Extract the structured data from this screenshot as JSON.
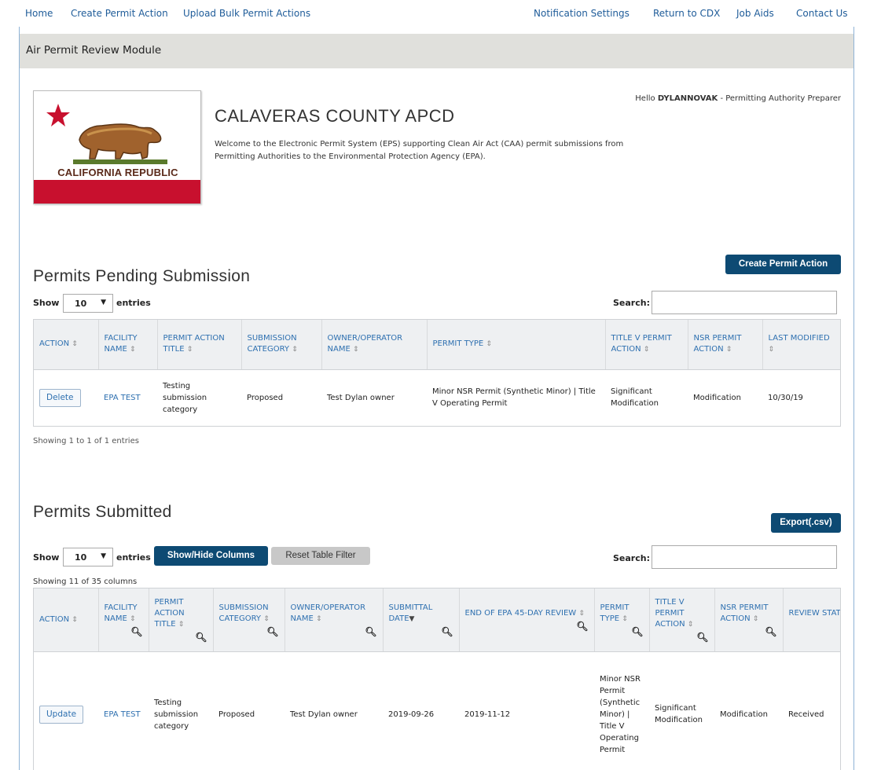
{
  "nav": {
    "left": [
      "Home",
      "Create Permit Action",
      "Upload Bulk Permit Actions"
    ],
    "right": [
      "Notification Settings",
      "Return to CDX",
      "Job Aids",
      "Contact Us"
    ]
  },
  "module_title": "Air Permit Review Module",
  "flag_text": "CALIFORNIA REPUBLIC",
  "agency_name": "CALAVERAS COUNTY APCD",
  "welcome": "Welcome to the Electronic Permit System (EPS) supporting Clean Air Act (CAA) permit submissions from Permitting Authorities to the Environmental Protection Agency (EPA).",
  "greeting": {
    "prefix": "Hello ",
    "user": "DYLANNOVAK",
    "suffix": " - Permitting Authority Preparer"
  },
  "pending": {
    "create_button": "Create Permit Action",
    "title": "Permits Pending Submission",
    "show_label": "Show",
    "entries_value": "10",
    "entries_label": "entries",
    "search_label": "Search:",
    "columns": [
      "ACTION",
      "FACILITY NAME",
      "PERMIT ACTION TITLE",
      "SUBMISSION CATEGORY",
      "OWNER/OPERATOR NAME",
      "PERMIT TYPE",
      "TITLE V PERMIT ACTION",
      "NSR PERMIT ACTION",
      "LAST MODIFIED"
    ],
    "row": {
      "action": "Delete",
      "facility": "EPA TEST",
      "title": "Testing submission category",
      "category": "Proposed",
      "owner": "Test Dylan owner",
      "permit_type": "Minor NSR Permit (Synthetic Minor) | Title V Operating Permit",
      "title_v": "Significant Modification",
      "nsr": "Modification",
      "modified": "10/30/19"
    },
    "info": "Showing 1 to 1 of 1 entries"
  },
  "submitted": {
    "export_button": "Export(.csv)",
    "title": "Permits Submitted",
    "show_label": "Show",
    "entries_value": "10",
    "entries_label": "entries",
    "show_hide_button": "Show/Hide Columns",
    "reset_button": "Reset Table Filter",
    "search_label": "Search:",
    "columns_info": "Showing 11 of 35 columns",
    "columns": [
      "ACTION",
      "FACILITY NAME",
      "PERMIT ACTION TITLE",
      "SUBMISSION CATEGORY",
      "OWNER/OPERATOR NAME",
      "SUBMITTAL DATE",
      "END OF EPA 45-DAY REVIEW",
      "PERMIT TYPE",
      "TITLE V PERMIT ACTION",
      "NSR PERMIT ACTION",
      "REVIEW STATUS"
    ],
    "row": {
      "action": "Update",
      "facility": "EPA TEST",
      "title": "Testing submission category",
      "category": "Proposed",
      "owner": "Test Dylan owner",
      "submittal": "2019-09-26",
      "end_review": "2019-11-12",
      "permit_type": "Minor NSR Permit (Synthetic Minor) | Title V Operating Permit",
      "title_v": "Significant Modification",
      "nsr": "Modification",
      "status": "Received"
    }
  }
}
